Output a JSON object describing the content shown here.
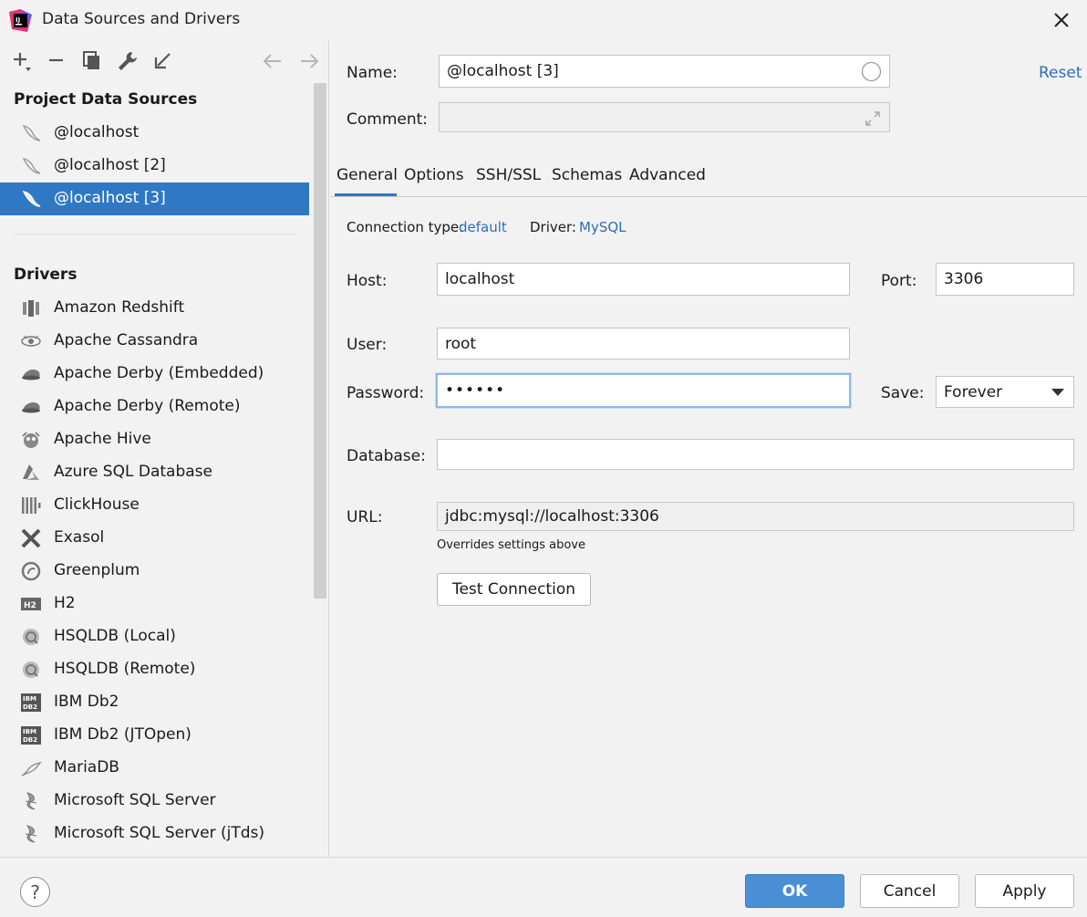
{
  "window": {
    "title": "Data Sources and Drivers"
  },
  "toolbar": {
    "icons": [
      "add-icon",
      "remove-icon",
      "copy-icon",
      "wrench-icon",
      "import-icon",
      "back-arrow-icon",
      "forward-arrow-icon"
    ]
  },
  "project": {
    "heading": "Project Data Sources",
    "items": [
      {
        "label": "@localhost",
        "icon": "mysql-dolphin-icon"
      },
      {
        "label": "@localhost [2]",
        "icon": "mysql-dolphin-icon"
      },
      {
        "label": "@localhost [3]",
        "icon": "mysql-dolphin-icon",
        "selected": true
      }
    ]
  },
  "drivers": {
    "heading": "Drivers",
    "items": [
      {
        "label": "Amazon Redshift",
        "icon": "redshift-icon"
      },
      {
        "label": "Apache Cassandra",
        "icon": "cassandra-eye-icon"
      },
      {
        "label": "Apache Derby (Embedded)",
        "icon": "derby-hat-icon"
      },
      {
        "label": "Apache Derby (Remote)",
        "icon": "derby-hat-icon"
      },
      {
        "label": "Apache Hive",
        "icon": "hive-bee-icon"
      },
      {
        "label": "Azure SQL Database",
        "icon": "azure-icon"
      },
      {
        "label": "ClickHouse",
        "icon": "clickhouse-bars-icon"
      },
      {
        "label": "Exasol",
        "icon": "exasol-x-icon"
      },
      {
        "label": "Greenplum",
        "icon": "greenplum-circle-icon"
      },
      {
        "label": "H2",
        "icon": "h2-icon"
      },
      {
        "label": "HSQLDB (Local)",
        "icon": "hsqldb-icon"
      },
      {
        "label": "HSQLDB (Remote)",
        "icon": "hsqldb-icon"
      },
      {
        "label": "IBM Db2",
        "icon": "ibm-db2-icon"
      },
      {
        "label": "IBM Db2 (JTOpen)",
        "icon": "ibm-db2-icon"
      },
      {
        "label": "MariaDB",
        "icon": "mariadb-seal-icon"
      },
      {
        "label": "Microsoft SQL Server",
        "icon": "sqlserver-icon"
      },
      {
        "label": "Microsoft SQL Server (jTds)",
        "icon": "sqlserver-icon"
      }
    ]
  },
  "form": {
    "name_label": "Name:",
    "name_value": "@localhost [3]",
    "reset_label": "Reset",
    "comment_label": "Comment:",
    "comment_value": "",
    "tabs": [
      "General",
      "Options",
      "SSH/SSL",
      "Schemas",
      "Advanced"
    ],
    "active_tab": "General",
    "connection_type_label": "Connection type:",
    "connection_type_value": "default",
    "driver_label": "Driver:",
    "driver_value": "MySQL",
    "host_label": "Host:",
    "host_value": "localhost",
    "port_label": "Port:",
    "port_value": "3306",
    "user_label": "User:",
    "user_value": "root",
    "password_label": "Password:",
    "password_value": "••••••",
    "save_label": "Save:",
    "save_value": "Forever",
    "database_label": "Database:",
    "database_value": "",
    "url_label": "URL:",
    "url_value": "jdbc:mysql://localhost:3306",
    "url_hint": "Overrides settings above",
    "test_button": "Test Connection"
  },
  "footer": {
    "help": "?",
    "ok": "OK",
    "cancel": "Cancel",
    "apply": "Apply"
  },
  "colors": {
    "accent": "#2f78c4",
    "link": "#2e6eb5",
    "primary_button": "#4a8ed6"
  }
}
